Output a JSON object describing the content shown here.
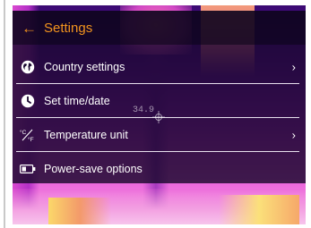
{
  "header": {
    "back_icon": "back-arrow-icon",
    "title": "Settings"
  },
  "menu": {
    "items": [
      {
        "label": "Country settings",
        "icon": "globe-icon",
        "has_submenu": true
      },
      {
        "label": "Set time/date",
        "icon": "clock-icon",
        "has_submenu": false
      },
      {
        "label": "Temperature unit",
        "icon": "temperature-unit-icon",
        "has_submenu": true
      },
      {
        "label": "Power-save options",
        "icon": "battery-icon",
        "has_submenu": false
      }
    ]
  },
  "measurement": {
    "value": "34.9"
  },
  "colors": {
    "accent": "#f2941e",
    "text": "#ffffff"
  }
}
